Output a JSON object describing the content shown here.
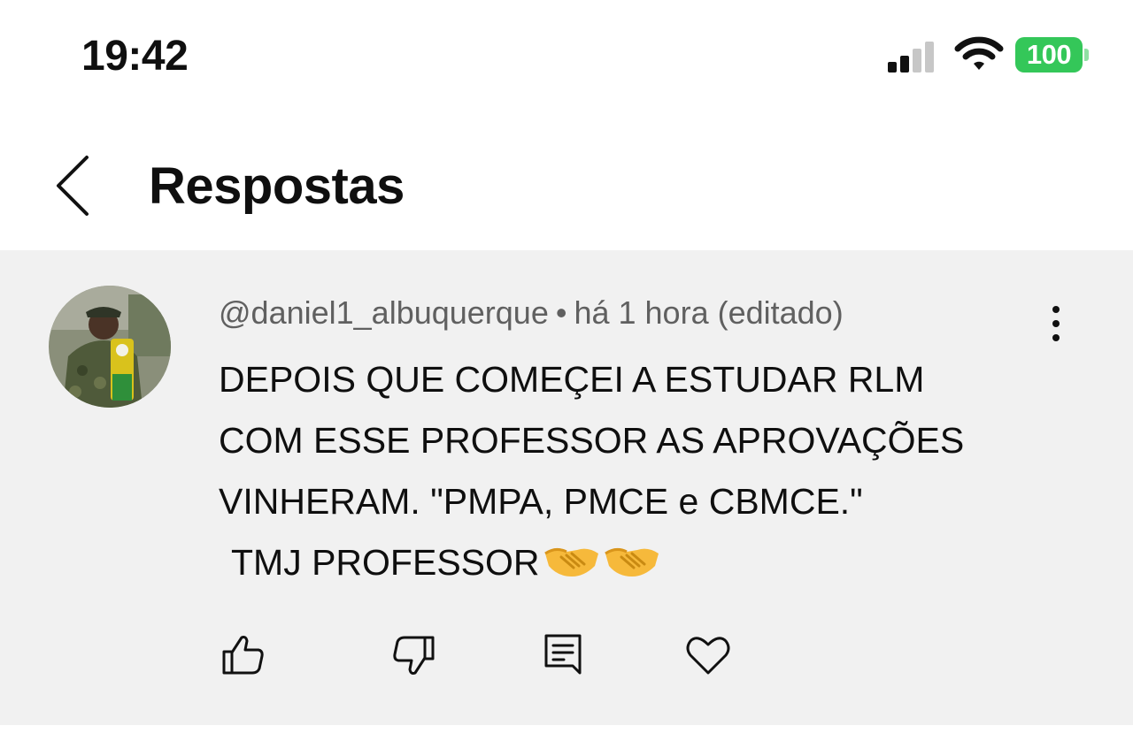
{
  "status_bar": {
    "time": "19:42",
    "battery": "100",
    "icons": [
      "signal-icon",
      "wifi-icon",
      "battery-icon"
    ],
    "battery_color": "#34c759"
  },
  "header": {
    "title": "Respostas",
    "back_icon": "chevron-left-icon"
  },
  "comment": {
    "author": "@daniel1_albuquerque",
    "separator": "•",
    "time": "há 1 hora (editado)",
    "lines": [
      "DEPOIS QUE COMEÇEI A ESTUDAR RLM",
      "COM ESSE PROFESSOR AS APROVAÇÕES",
      "VINHERAM. \"PMPA, PMCE e CBMCE.\"",
      "TMJ PROFESSOR"
    ],
    "emojis": [
      "handshake-emoji",
      "handshake-emoji"
    ],
    "more_icon": "more-vert-icon",
    "actions": [
      "like-icon",
      "dislike-icon",
      "reply-icon",
      "heart-icon"
    ],
    "background_color": "#f1f1f1"
  }
}
